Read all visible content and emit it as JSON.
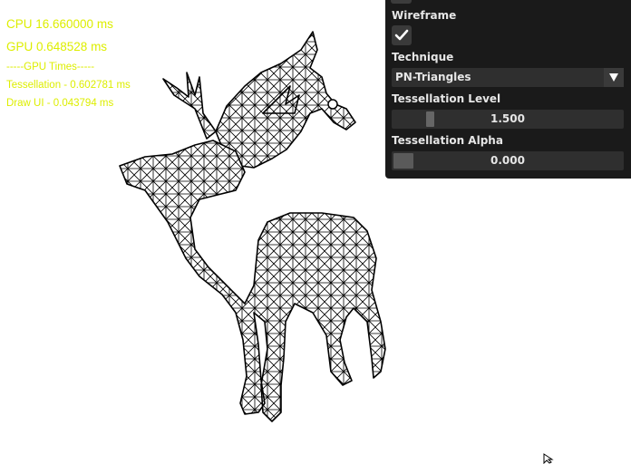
{
  "stats": {
    "cpu": "CPU 16.660000 ms",
    "gpu": "GPU 0.648528 ms",
    "gpu_times_header": "-----GPU Times-----",
    "tessellation": "Tessellation -  0.602781 ms",
    "draw_ui": "Draw UI -  0.043794 ms"
  },
  "panel": {
    "wireframe_label": "Wireframe",
    "wireframe_checked": true,
    "technique_label": "Technique",
    "technique_value": "PN-Triangles",
    "tess_level_label": "Tessellation Level",
    "tess_level_value": "1.500",
    "tess_alpha_label": "Tessellation Alpha",
    "tess_alpha_value": "0.000"
  },
  "icons": {
    "checkmark": "check-icon",
    "dropdown": "triangle-down-icon",
    "cursor": "mouse-pointer-icon"
  },
  "colors": {
    "stats_text": "#ddee00",
    "panel_bg": "#1a1a1a",
    "wireframe": "#000000"
  }
}
